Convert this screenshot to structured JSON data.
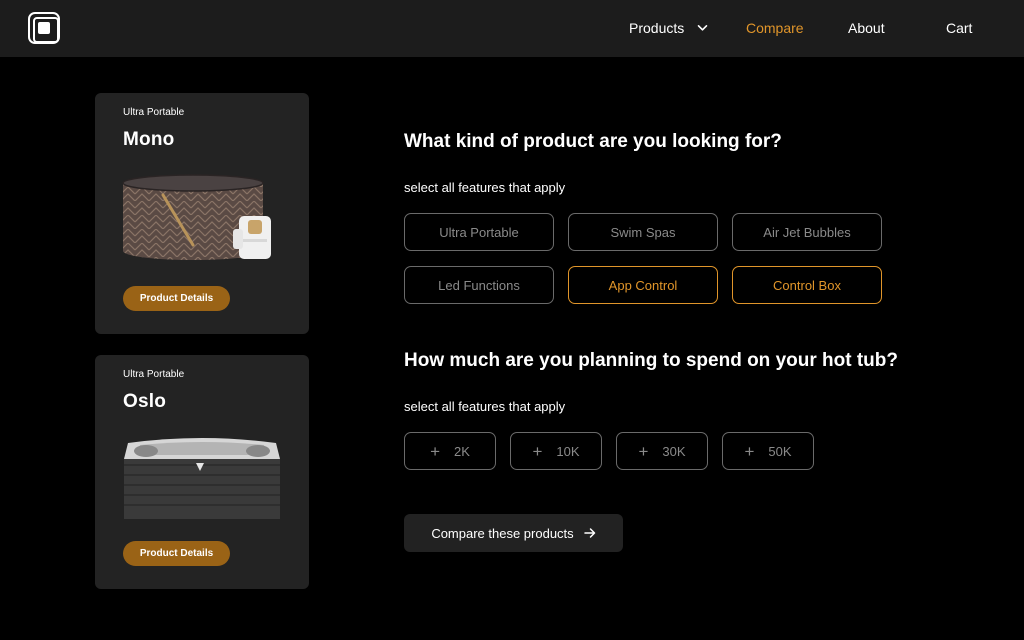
{
  "nav": {
    "products": "Products",
    "compare": "Compare",
    "about": "About",
    "cart": "Cart",
    "active_color": "#e0952a"
  },
  "cards": [
    {
      "tag": "Ultra Portable",
      "name": "Mono",
      "button": "Product Details"
    },
    {
      "tag": "Ultra Portable",
      "name": "Oslo",
      "button": "Product Details"
    }
  ],
  "q1": {
    "title": "What kind of product are you looking for?",
    "subtitle": "select all features that apply",
    "options": [
      {
        "label": "Ultra Portable",
        "selected": false
      },
      {
        "label": "Swim Spas",
        "selected": false
      },
      {
        "label": "Air Jet Bubbles",
        "selected": false
      },
      {
        "label": "Led Functions",
        "selected": false
      },
      {
        "label": "App Control",
        "selected": true
      },
      {
        "label": "Control Box",
        "selected": true
      }
    ]
  },
  "q2": {
    "title": "How much are you planning to spend on your hot tub?",
    "subtitle": "select all features that apply",
    "prices": [
      "2K",
      "10K",
      "30K",
      "50K"
    ]
  },
  "compare_button": "Compare these products",
  "icons": [
    "logo-icon",
    "chevron-down-icon",
    "plus-icon",
    "arrow-right-icon"
  ],
  "colors": {
    "accent": "#e0952a",
    "button_brown": "#9a6316",
    "card_bg": "#232323",
    "header_bg": "#1c1c1c"
  }
}
